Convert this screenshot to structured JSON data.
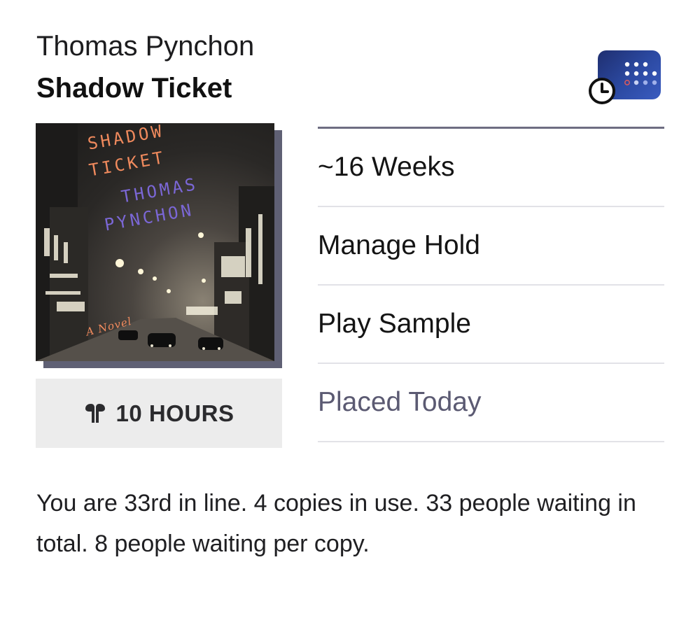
{
  "book": {
    "author": "Thomas Pynchon",
    "title": "Shadow Ticket"
  },
  "hold_badge": {
    "icon": "hold-clock-icon",
    "accent": "#2c4aa3"
  },
  "cover": {
    "line1": "SHADOW",
    "line2": "TICKET",
    "line3": "THOMAS",
    "line4": "PYNCHON",
    "subtitle": "A Novel",
    "title_color": "#f08a5d",
    "author_color": "#7b67d6"
  },
  "duration": {
    "icon": "headphones-icon",
    "label": "10 HOURS"
  },
  "actions": {
    "estimate": "~16 Weeks",
    "manage_hold": "Manage Hold",
    "play_sample": "Play Sample",
    "placed": "Placed Today"
  },
  "summary": "You are 33rd in line. 4 copies in use. 33 people waiting in total. 8 people waiting per copy."
}
